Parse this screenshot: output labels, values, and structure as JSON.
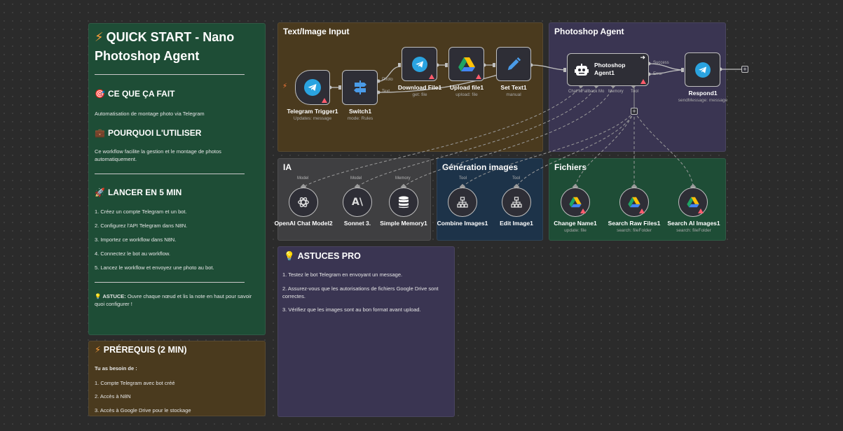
{
  "quickstart": {
    "title_line1": "QUICK START - Nano",
    "title_line2": "Photoshop Agent",
    "sec1_title": "CE QUE ÇA FAIT",
    "sec1_text": "Automatisation de montage photo via Telegram",
    "sec2_title": "POURQUOI L'UTILISER",
    "sec2_text": "Ce workflow facilite la gestion et le montage de photos automatiquement.",
    "sec3_title": "LANCER EN 5 MIN",
    "steps": [
      "1. Créez un compte Telegram et un bot.",
      "2. Configurez l'API Telegram dans N8N.",
      "3. Importez ce workflow dans N8N.",
      "4. Connectez le bot au workflow.",
      "5. Lancez le workflow et envoyez une photo au bot."
    ],
    "tip_label": "ASTUCE:",
    "tip_text": "Ouvre chaque nœud et lis la note en haut pour savoir quoi configurer !"
  },
  "prereq": {
    "title": "PRÉREQUIS (2 MIN)",
    "intro": "Tu as besoin de :",
    "items": [
      "1. Compte Telegram avec bot créé",
      "2. Accès à N8N",
      "3. Accès à Google Drive pour le stockage"
    ]
  },
  "groups": {
    "text_image_input": "Text/Image Input",
    "photoshop_agent": "Photoshop Agent",
    "ia": "IA",
    "generation_images": "Génération images",
    "fichiers": "Fichiers"
  },
  "astuces": {
    "title": "ASTUCES PRO",
    "items": [
      "1. Testez le bot Telegram en envoyant un message.",
      "2. Assurez-vous que les autorisations de fichiers Google Drive sont correctes.",
      "3. Vérifiez que les images sont au bon format avant upload."
    ]
  },
  "nodes": {
    "telegram_trigger": {
      "label": "Telegram Trigger1",
      "sub": "Updates: message"
    },
    "switch": {
      "label": "Switch1",
      "sub": "mode: Rules",
      "out_photo": "Photo",
      "out_text": "Text"
    },
    "download_file": {
      "label": "Download File1",
      "sub": "get: file"
    },
    "upload_file": {
      "label": "Upload file1",
      "sub": "upload: file"
    },
    "set_text": {
      "label": "Set Text1",
      "sub": "manual"
    },
    "agent": {
      "label_line1": "Photoshop",
      "label_line2": "Agent1",
      "out_success": "Success",
      "out_error": "Error",
      "port_chat": "Chat M",
      "port_fallback": "Fallback Mo",
      "port_memory": "Memory",
      "port_tool": "Tool"
    },
    "respond": {
      "label": "Respond1",
      "sub": "sendMessage: message"
    },
    "openai": {
      "label": "OpenAI Chat Model2",
      "port": "Model"
    },
    "sonnet": {
      "label": "Sonnet 3.",
      "port": "Model"
    },
    "memory": {
      "label": "Simple Memory1",
      "port": "Memory"
    },
    "combine": {
      "label": "Combine Images1",
      "port": "Tool"
    },
    "edit": {
      "label": "Edit Image1",
      "port": "Tool"
    },
    "change_name": {
      "label": "Change Name1",
      "sub": "update: file"
    },
    "search_raw": {
      "label": "Search Raw Files1",
      "sub": "search: fileFolder"
    },
    "search_ai": {
      "label": "Search AI Images1",
      "sub": "search: fileFolder"
    }
  },
  "colors": {
    "green_note": "#1e4d36",
    "brown_note": "#4a3a1e",
    "purple_note": "#3a3552",
    "gray_note": "#3f3f41",
    "blue_note": "#1d3349",
    "telegram": "#2aa3e0",
    "warning": "#ff5c6c"
  }
}
